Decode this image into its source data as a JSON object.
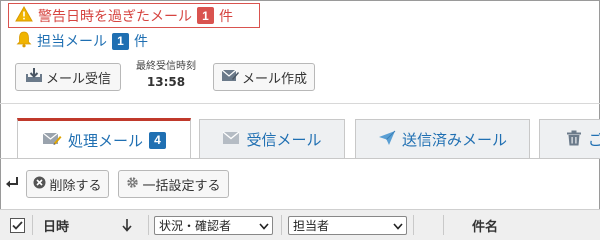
{
  "alert": {
    "text": "警告日時を過ぎたメール",
    "count": "1",
    "unit": "件"
  },
  "assigned": {
    "text": "担当メール",
    "count": "1",
    "unit": "件"
  },
  "toolbar": {
    "receive_label": "メール受信",
    "last_received_label": "最終受信時刻",
    "last_received_time": "13:58",
    "compose_label": "メール作成"
  },
  "tabs": [
    {
      "label": "処理メール",
      "badge": "4"
    },
    {
      "label": "受信メール"
    },
    {
      "label": "送信済みメール"
    },
    {
      "label": "ご"
    }
  ],
  "actions": {
    "delete_label": "削除する",
    "bulk_label": "一括設定する"
  },
  "table_header": {
    "date_label": "日時",
    "status_select": "状況・確認者",
    "assignee_select": "担当者",
    "subject_label": "件名"
  },
  "colors": {
    "alert_red": "#d64541",
    "badge_blue": "#1f6fb2",
    "badge_red": "#d9534f",
    "link_blue": "#1f6fb2"
  }
}
